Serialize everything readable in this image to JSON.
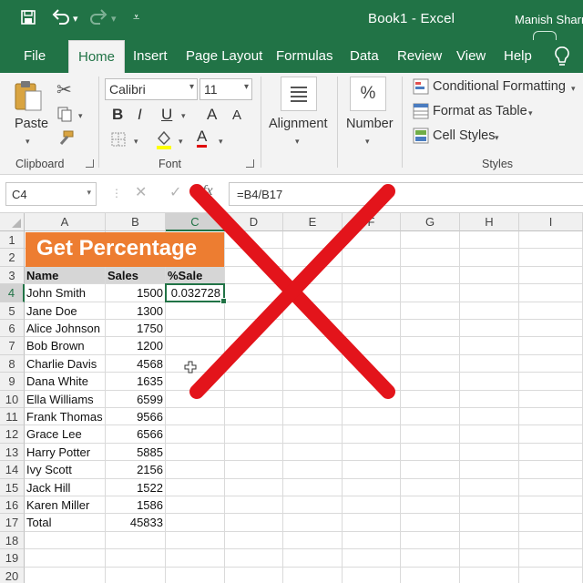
{
  "titlebar": {
    "title": "Book1  -  Excel",
    "user": "Manish Sharr",
    "icons": [
      "save-icon",
      "undo-icon",
      "redo-icon",
      "customize-qat-icon"
    ]
  },
  "tabs": [
    {
      "label": "File",
      "active": false
    },
    {
      "label": "Home",
      "active": true
    },
    {
      "label": "Insert",
      "active": false
    },
    {
      "label": "Page Layout",
      "active": false
    },
    {
      "label": "Formulas",
      "active": false
    },
    {
      "label": "Data",
      "active": false
    },
    {
      "label": "Review",
      "active": false
    },
    {
      "label": "View",
      "active": false
    },
    {
      "label": "Help",
      "active": false
    }
  ],
  "ribbon": {
    "clipboard": {
      "paste_label": "Paste",
      "group_label": "Clipboard"
    },
    "font": {
      "font_name": "Calibri",
      "font_size": "11",
      "bold": "B",
      "italic": "I",
      "underline": "U",
      "grow": "A",
      "shrink": "A",
      "font_color": "A",
      "group_label": "Font"
    },
    "alignment": {
      "label": "Alignment"
    },
    "number": {
      "label": "Number",
      "icon_text": "%"
    },
    "styles": {
      "conditional_formatting": "Conditional Formatting",
      "format_as_table": "Format as Table",
      "cell_styles": "Cell Styles",
      "group_label": "Styles"
    }
  },
  "formula_bar": {
    "name_box": "C4",
    "cancel": "✕",
    "enter": "✓",
    "fx": "fx",
    "formula": "=B4/B17"
  },
  "sheet": {
    "columns": [
      "A",
      "B",
      "C",
      "D",
      "E",
      "F",
      "G",
      "H",
      "I"
    ],
    "selected_column": "C",
    "rows": [
      "1",
      "2",
      "3",
      "4",
      "5",
      "6",
      "7",
      "8",
      "9",
      "10",
      "11",
      "12",
      "13",
      "14",
      "15",
      "16",
      "17",
      "18",
      "19",
      "20"
    ],
    "selected_row": "4",
    "banner": "Get Percentage",
    "headers": {
      "name": "Name",
      "sales": "Sales",
      "pct": "%Sale"
    },
    "data": [
      {
        "name": "John Smith",
        "sales": "1500"
      },
      {
        "name": "Jane Doe",
        "sales": "1300"
      },
      {
        "name": "Alice Johnson",
        "sales": "1750"
      },
      {
        "name": "Bob Brown",
        "sales": "1200"
      },
      {
        "name": "Charlie Davis",
        "sales": "4568"
      },
      {
        "name": "Dana White",
        "sales": "1635"
      },
      {
        "name": "Ella Williams",
        "sales": "6599"
      },
      {
        "name": "Frank Thomas",
        "sales": "9566"
      },
      {
        "name": "Grace Lee",
        "sales": "6566"
      },
      {
        "name": "Harry Potter",
        "sales": "5885"
      },
      {
        "name": "Ivy Scott",
        "sales": "2156"
      },
      {
        "name": "Jack Hill",
        "sales": "1522"
      },
      {
        "name": "Karen Miller",
        "sales": "1586"
      }
    ],
    "total": {
      "name": "Total",
      "sales": "45833"
    },
    "active_cell_value": "0.032728"
  },
  "colors": {
    "excel_green": "#217346",
    "banner_orange": "#ed7d31",
    "cross_red": "#e3141b"
  }
}
